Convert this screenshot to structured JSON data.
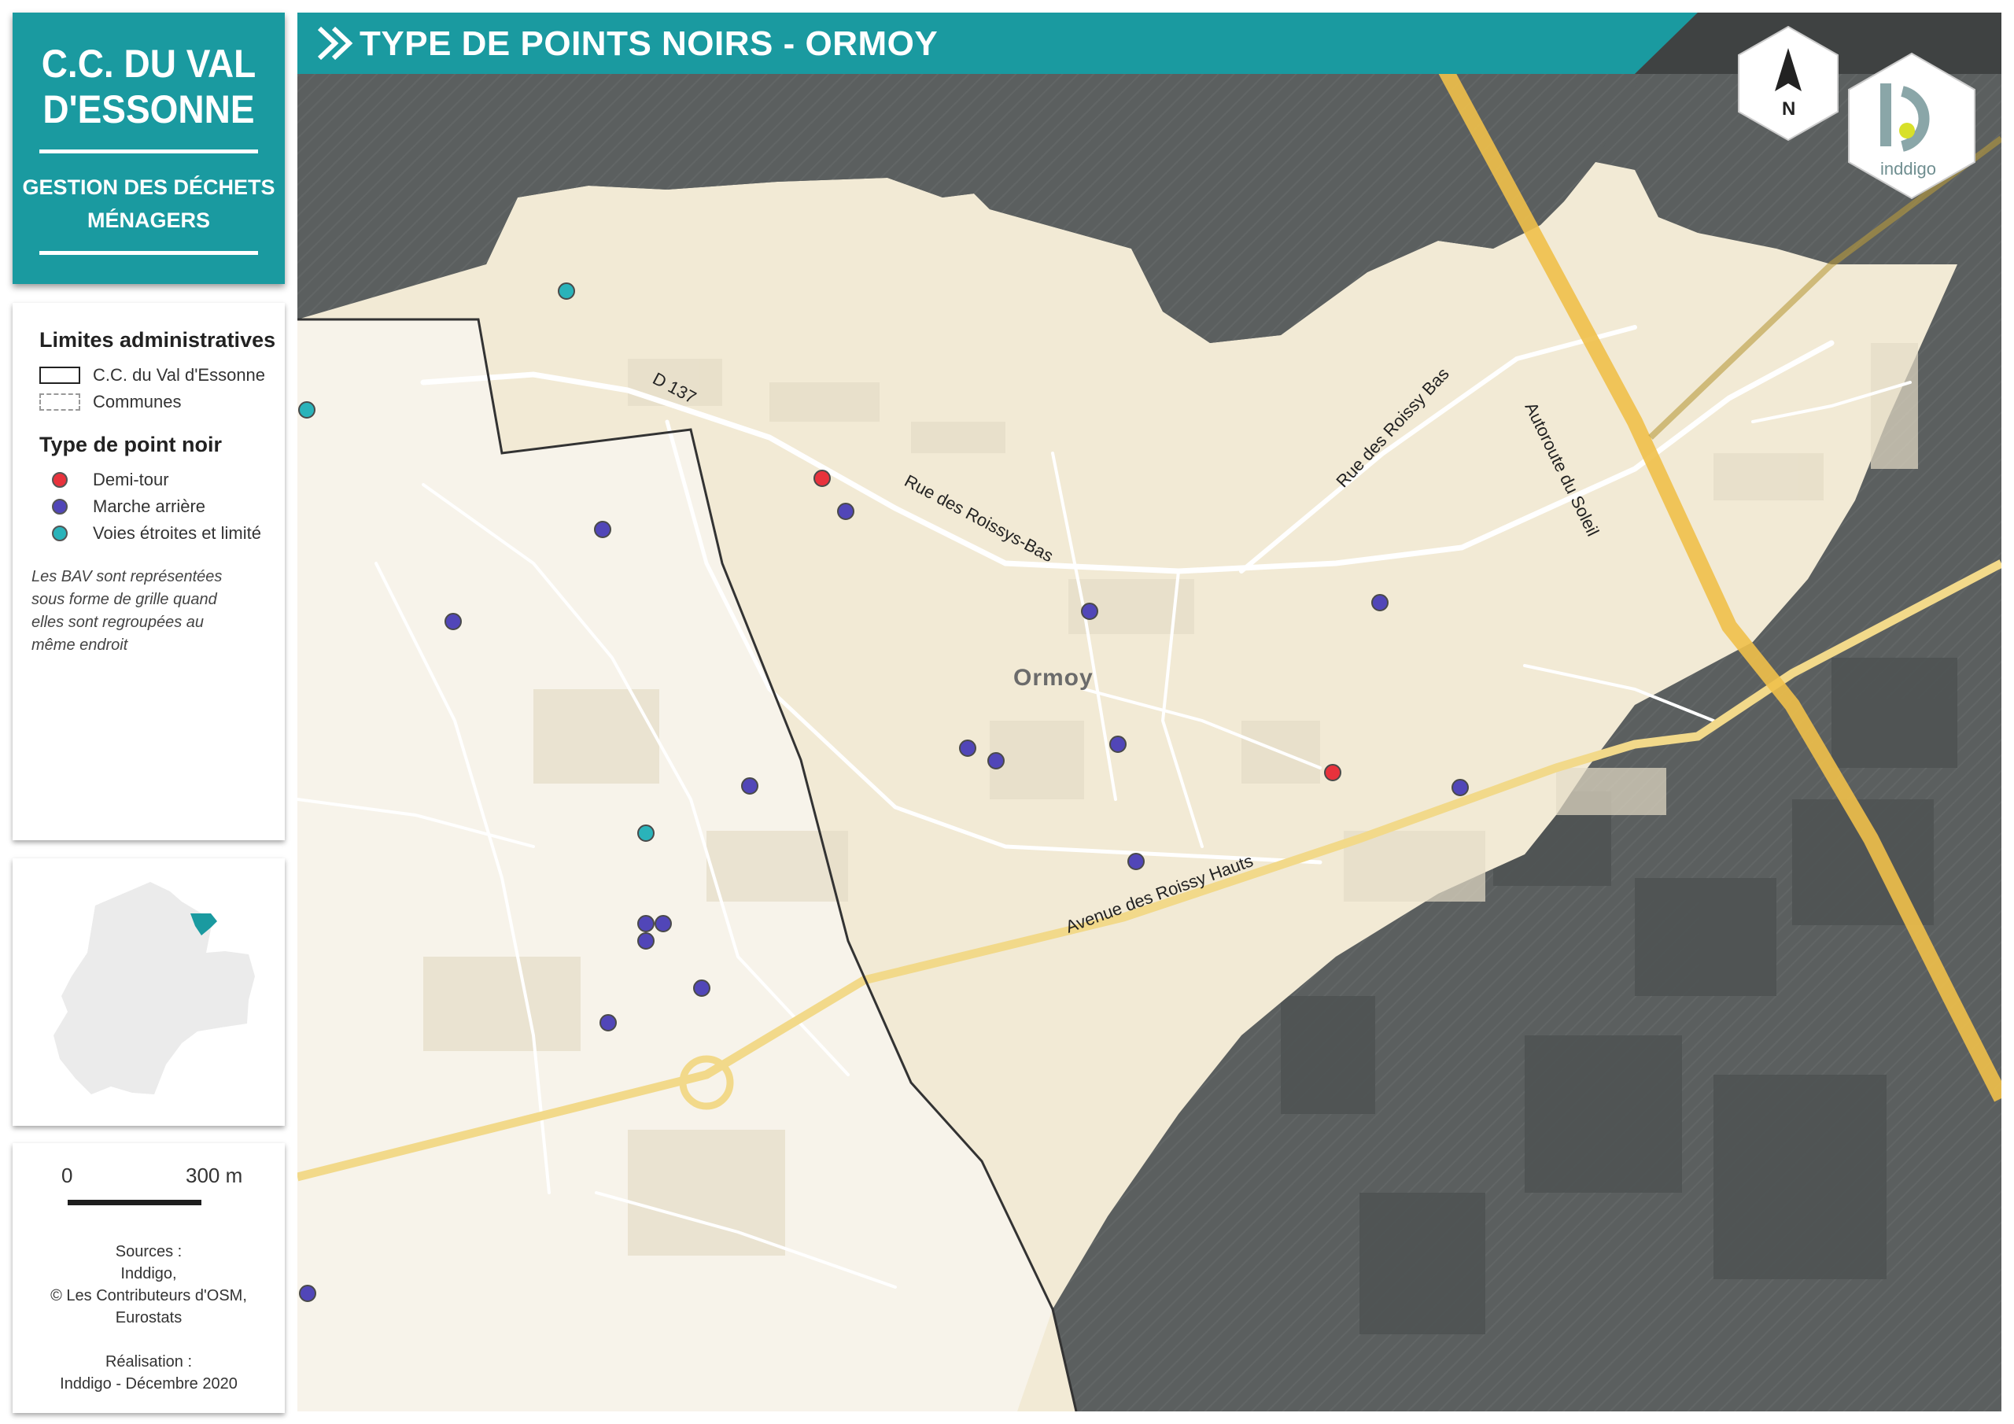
{
  "header": {
    "org_title": "C.C. DU VAL D'ESSONNE",
    "org_subtitle": "GESTION DES DÉCHETS MÉNAGERS",
    "map_title": "TYPE DE POINTS NOIRS - ORMOY"
  },
  "legend": {
    "admin_title": "Limites administratives",
    "admin_items": [
      "C.C. du Val d'Essonne",
      "Communes"
    ],
    "type_title": "Type de point noir",
    "types": [
      {
        "label": "Demi-tour",
        "color": "#e8323c"
      },
      {
        "label": "Marche arrière",
        "color": "#5146b8"
      },
      {
        "label": "Voies étroites et limité",
        "color": "#2ab3ba"
      }
    ],
    "note": "Les BAV sont représentées sous forme de grille quand elles sont regroupées au même endroit"
  },
  "scale": {
    "zero": "0",
    "end": "300 m"
  },
  "sources": {
    "label": "Sources :",
    "lines": [
      "Inddigo,",
      "© Les Contributeurs d'OSM,",
      "Eurostats"
    ],
    "realisation_label": "Réalisation :",
    "realisation": "Inddigo - Décembre 2020"
  },
  "map": {
    "commune_label": "Ormoy",
    "roads": [
      "D 137",
      "Rue des Roissys-Bas",
      "Rue des Roissy Bas",
      "Autoroute du Soleil",
      "Avenue des Roissy Hauts"
    ],
    "north_label": "N",
    "logo_text": "inddigo",
    "colors": {
      "inside": "#f2ead5",
      "outside": "#5a5e5e",
      "header": "#1a9aa0"
    }
  }
}
